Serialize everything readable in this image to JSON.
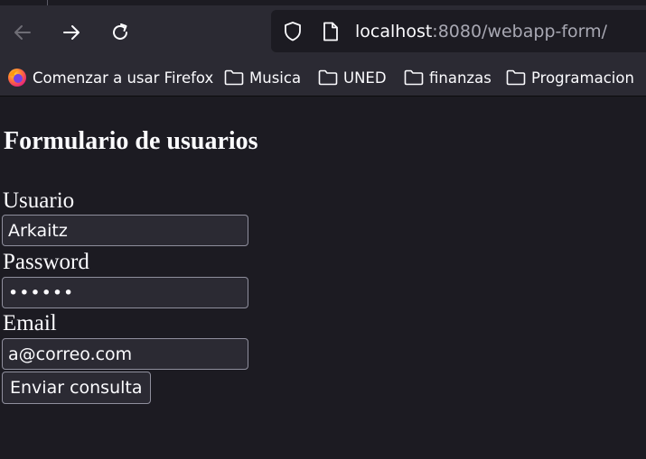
{
  "browser": {
    "url_host": "localhost",
    "url_path": ":8080/webapp-form/",
    "bookmarks": [
      {
        "label": "Comenzar a usar Firefox",
        "icon": "firefox-icon"
      },
      {
        "label": "Musica",
        "icon": "folder-icon"
      },
      {
        "label": "UNED",
        "icon": "folder-icon"
      },
      {
        "label": "finanzas",
        "icon": "folder-icon"
      },
      {
        "label": "Programacion",
        "icon": "folder-icon"
      }
    ]
  },
  "page": {
    "title": "Formulario de usuarios",
    "fields": [
      {
        "label": "Usuario",
        "value": "Arkaitz",
        "type": "text"
      },
      {
        "label": "Password",
        "value": "arkait",
        "type": "password"
      },
      {
        "label": "Email",
        "value": "a@correo.com",
        "type": "email"
      }
    ],
    "submit_label": "Enviar consulta"
  },
  "colors": {
    "page_background": "#1c1b22",
    "toolbar_background": "#2b2a33",
    "text": "#fbfbfe",
    "input_border": "#8f8f9d"
  }
}
